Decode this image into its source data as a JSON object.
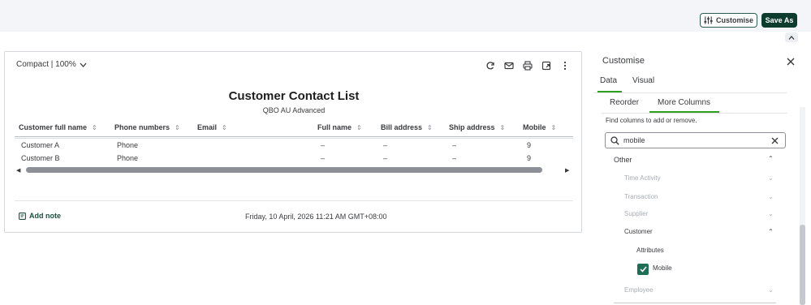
{
  "header": {
    "customise_label": "Customise",
    "save_as_label": "Save As"
  },
  "report": {
    "view_mode": "Compact | 100%",
    "title": "Customer Contact List",
    "subtitle": "QBO AU Advanced",
    "columns": [
      "Customer full name",
      "Phone numbers",
      "Email",
      "Full name",
      "Bill address",
      "Ship address",
      "Mobile"
    ],
    "rows": [
      [
        "Customer A",
        "Phone",
        "",
        "–",
        "–",
        "–",
        "9"
      ],
      [
        "Customer B",
        "Phone",
        "",
        "–",
        "–",
        "–",
        "9"
      ]
    ],
    "add_note_label": "Add note",
    "timestamp": "Friday, 10 April, 2026 11:21 AM GMT+08:00"
  },
  "panel": {
    "title": "Customise",
    "tabs": [
      "Data",
      "Visual"
    ],
    "active_tab": "Data",
    "subtabs": [
      "Reorder",
      "More Columns"
    ],
    "active_subtab": "More Columns",
    "hint": "Find columns to add or remove.",
    "search_value": "mobile",
    "group": "Other",
    "categories": [
      "Time Activity",
      "Transaction",
      "Supplier",
      "Customer",
      "Employee"
    ],
    "expanded_category": "Customer",
    "attributes_label": "Attributes",
    "checkbox_label": "Mobile",
    "checkbox_checked": true
  },
  "icons": [
    "tune-icon",
    "chevron-up-icon",
    "chevron-down-icon",
    "refresh-icon",
    "email-icon",
    "print-icon",
    "export-icon",
    "more-vert-icon",
    "sort-icon",
    "note-icon",
    "close-icon",
    "search-icon",
    "check-icon"
  ],
  "colors": {
    "primary_dark_green": "#0d3b2e",
    "accent_green": "#2ca01c",
    "checkbox_green": "#1d6e54"
  }
}
